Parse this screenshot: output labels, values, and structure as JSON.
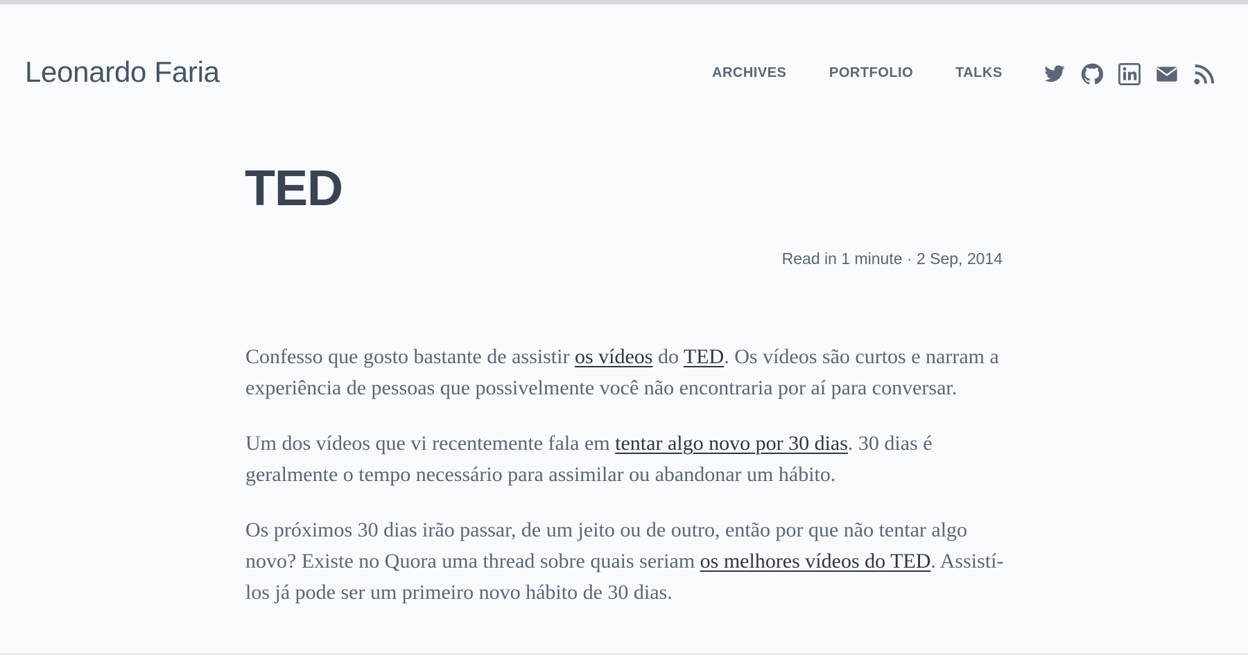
{
  "site": {
    "title": "Leonardo Faria"
  },
  "nav": {
    "archives": "ARCHIVES",
    "portfolio": "PORTFOLIO",
    "talks": "TALKS"
  },
  "social_icons": [
    "twitter-icon",
    "github-icon",
    "linkedin-icon",
    "email-icon",
    "rss-icon"
  ],
  "colors": {
    "background": "#f8fafc",
    "text": "#5c6678",
    "heading": "#3a4352",
    "link": "#2f3745"
  },
  "post": {
    "title": "TED",
    "meta": "Read in 1 minute · 2 Sep, 2014",
    "p1": {
      "t1": "Confesso que gosto bastante de assistir ",
      "l1": "os vídeos",
      "t2": " do ",
      "l2": "TED",
      "t3": ". Os vídeos são curtos e narram a experiência de pessoas que possivelmente você não encontraria por aí para conversar."
    },
    "p2": {
      "t1": "Um dos vídeos que vi recentemente fala em ",
      "l1": "tentar algo novo por 30 dias",
      "t2": ". 30 dias é geralmente o tempo necessário para assimilar ou abandonar um hábito."
    },
    "p3": {
      "t1": "Os próximos 30 dias irão passar, de um jeito ou de outro, então por que não tentar algo novo? Existe no Quora uma thread sobre quais seriam ",
      "l1": "os melhores vídeos do TED",
      "t2": ". Assistí-los já pode ser um primeiro novo hábito de 30 dias."
    }
  }
}
